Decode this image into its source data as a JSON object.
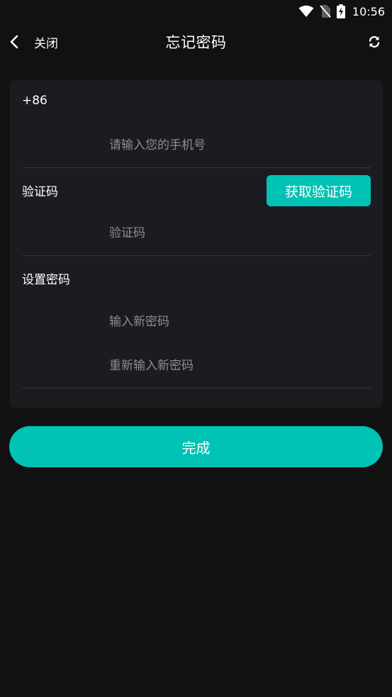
{
  "status_bar": {
    "time": "10:56",
    "icons": [
      "wifi-icon",
      "no-sim-icon",
      "battery-charging-icon"
    ]
  },
  "app_bar": {
    "back_label": "关闭",
    "title": "忘记密码",
    "back_icon": "chevron-left-icon",
    "refresh_icon": "refresh-icon"
  },
  "form": {
    "phone": {
      "country_code": "+86",
      "value": "",
      "placeholder": "请输入您的手机号"
    },
    "verification": {
      "label": "验证码",
      "button_label": "获取验证码",
      "value": "",
      "placeholder": "验证码"
    },
    "password": {
      "label": "设置密码",
      "new_value": "",
      "new_placeholder": "输入新密码",
      "confirm_value": "",
      "confirm_placeholder": "重新输入新密码"
    }
  },
  "submit": {
    "label": "完成"
  },
  "colors": {
    "background": "#121112",
    "card": "#1b1c1f",
    "accent": "#00c3b5",
    "placeholder": "#8d8e91",
    "divider": "#34353a"
  }
}
